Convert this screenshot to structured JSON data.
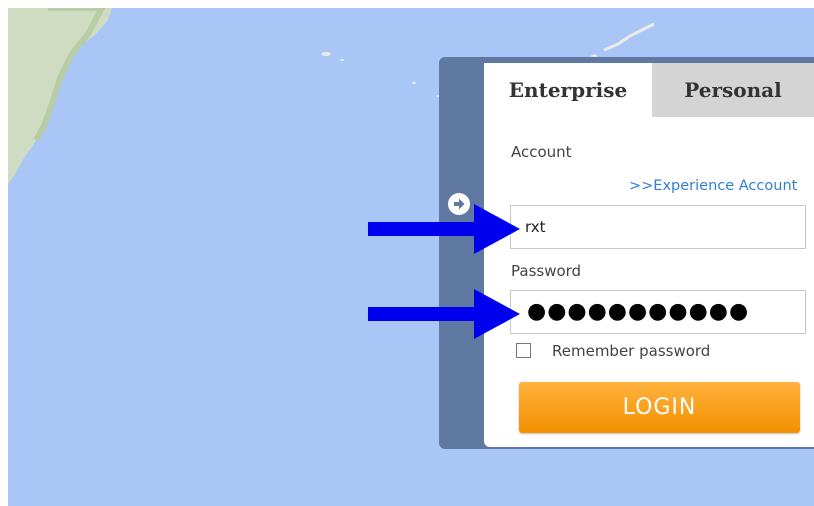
{
  "tabs": [
    {
      "label": "Enterprise",
      "active": true
    },
    {
      "label": "Personal",
      "active": false
    }
  ],
  "form": {
    "account_label": "Account",
    "experience_link": ">>Experience Account",
    "account_value": "rxt",
    "password_label": "Password",
    "password_mask": "●●●●●●●●●●●",
    "remember_label": "Remember password",
    "remember_checked": false,
    "login_label": "LOGIN"
  },
  "icons": {
    "toggle": "arrow-right-circle-icon",
    "pointer": "blue-arrow-icon"
  },
  "colors": {
    "map_water": "#a9c6f7",
    "panel_frame": "#5f79a3",
    "login_orange": "#f7a21b",
    "link_blue": "#2f7fd3",
    "annotation_arrow": "#0000ee"
  }
}
